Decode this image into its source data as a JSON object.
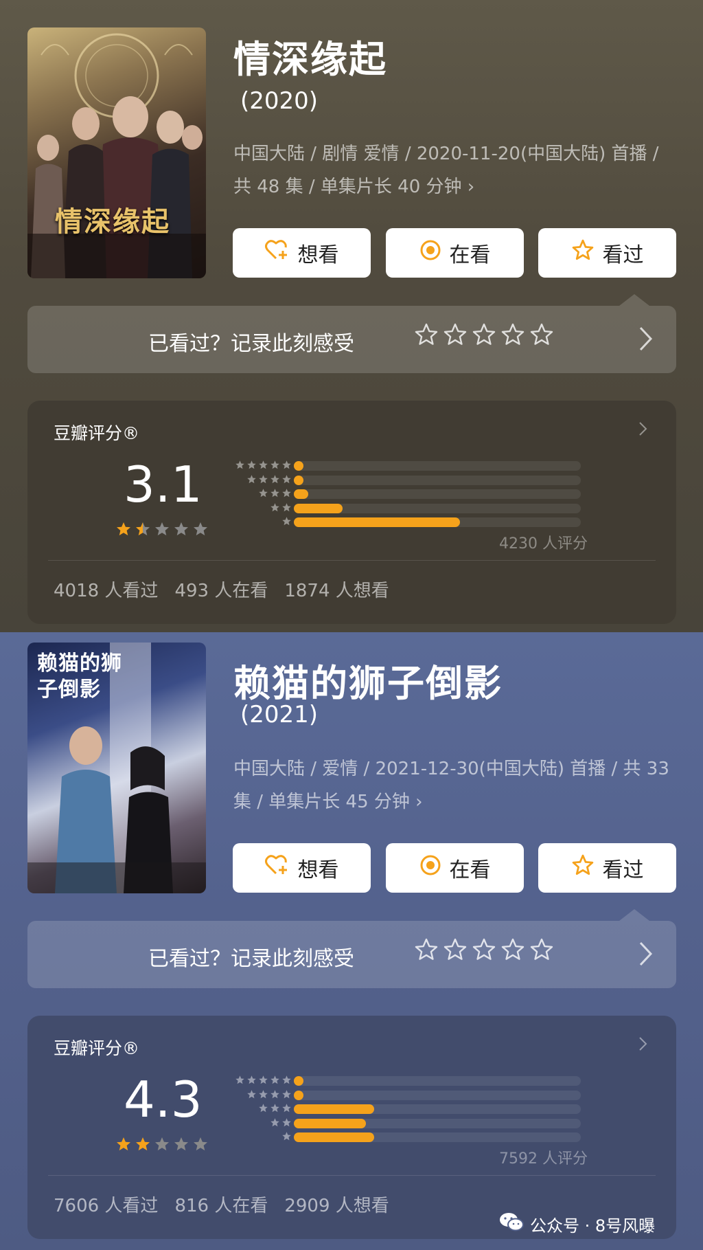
{
  "shows": [
    {
      "title": "情深缘起",
      "year": "(2020)",
      "poster_title": "情深缘起",
      "meta": "中国大陆 / 剧情 爱情 / 2020-11-20(中国大陆) 首播 / 共 48 集 / 单集片长 40 分钟 ›",
      "buttons": {
        "want": "想看",
        "watching": "在看",
        "watched": "看过"
      },
      "record_prompt": "已看过？记录此刻感受",
      "rating_label": "豆瓣评分®",
      "score": "3.1",
      "score_stars": 1.5,
      "distribution": [
        0.02,
        0.02,
        0.05,
        0.17,
        0.58
      ],
      "rating_count": "4230 人评分",
      "counts": {
        "watched": "4018 人看过",
        "watching": "493 人在看",
        "want": "1874 人想看"
      }
    },
    {
      "title": "赖猫的狮子倒影",
      "year": "(2021)",
      "poster_title": "赖猫的狮子倒影",
      "meta": "中国大陆 / 爱情 / 2021-12-30(中国大陆) 首播 / 共 33 集 / 单集片长 45 分钟 ›",
      "buttons": {
        "want": "想看",
        "watching": "在看",
        "watched": "看过"
      },
      "record_prompt": "已看过？记录此刻感受",
      "rating_label": "豆瓣评分®",
      "score": "4.3",
      "score_stars": 2,
      "distribution": [
        0.02,
        0.02,
        0.28,
        0.25,
        0.28
      ],
      "rating_count": "7592 人评分",
      "counts": {
        "watched": "7606 人看过",
        "watching": "816 人在看",
        "want": "2909 人想看"
      }
    }
  ],
  "watermark": "公众号 · 8号风曝",
  "colors": {
    "accent": "#f5a21b",
    "star_empty": "#8a8a8a"
  }
}
